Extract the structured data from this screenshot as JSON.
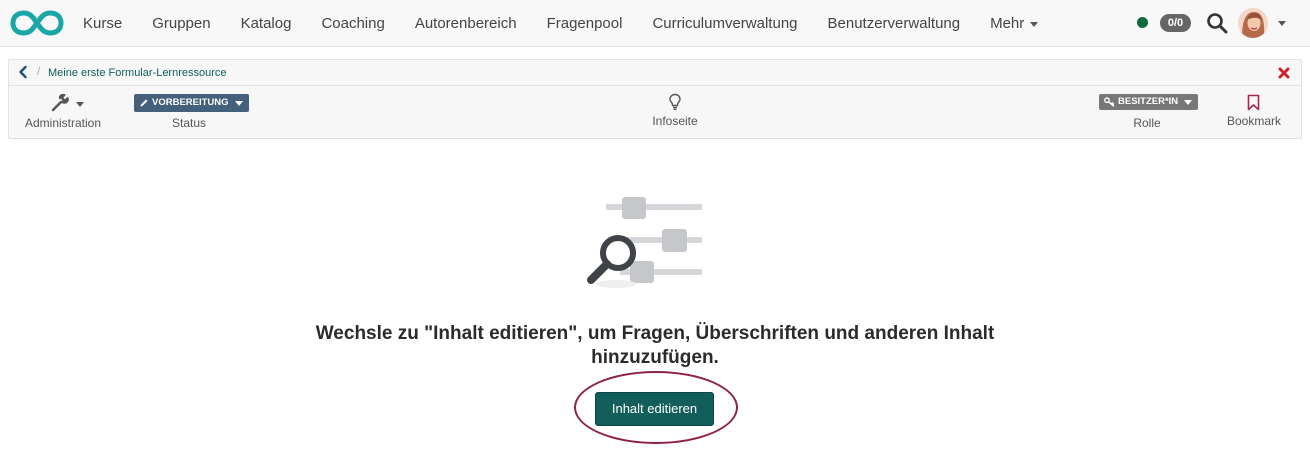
{
  "nav": {
    "items": [
      {
        "label": "Kurse"
      },
      {
        "label": "Gruppen"
      },
      {
        "label": "Katalog"
      },
      {
        "label": "Coaching"
      },
      {
        "label": "Autorenbereich"
      },
      {
        "label": "Fragenpool"
      },
      {
        "label": "Curriculumverwaltung"
      },
      {
        "label": "Benutzerverwaltung"
      },
      {
        "label": "Mehr"
      }
    ],
    "badge_count": "0/0",
    "online_status_color": "#0b6b3a",
    "icons": [
      "infinity-logo-icon",
      "search-icon",
      "chevron-down-icon"
    ]
  },
  "breadcrumb": {
    "separator": "/",
    "current": "Meine erste Formular-Lernressource"
  },
  "toolbar": {
    "administration_label": "Administration",
    "status_value": "VORBEREITUNG",
    "status_label": "Status",
    "infopage_label": "Infoseite",
    "role_value": "BESITZER*IN",
    "role_label": "Rolle",
    "bookmark_label": "Bookmark"
  },
  "main": {
    "message": "Wechsle zu \"Inhalt editieren\", um Fragen, Überschriften und anderen Inhalt hinzuzufügen.",
    "edit_button_label": "Inhalt editieren"
  },
  "colors": {
    "accent": "#115e5b",
    "logo": "#1ba6a6",
    "status_pill": "#45607a",
    "close": "#d0202a",
    "bookmark": "#a3294f",
    "highlight_ring": "#8e2244"
  }
}
